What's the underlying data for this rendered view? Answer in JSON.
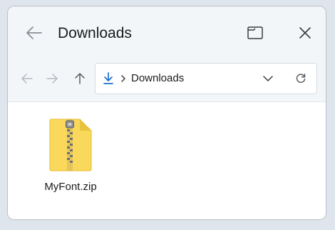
{
  "window": {
    "title": "Downloads"
  },
  "titlebar": {
    "back_icon": "arrow-left-icon",
    "restore_icon": "restore-window-icon",
    "close_icon": "close-icon"
  },
  "navigation": {
    "back_icon": "arrow-left-icon",
    "forward_icon": "arrow-right-icon",
    "up_icon": "arrow-up-icon"
  },
  "address_bar": {
    "location_icon": "download-icon",
    "separator_icon": "chevron-right-icon",
    "path": "Downloads",
    "dropdown_icon": "chevron-down-icon",
    "refresh_icon": "refresh-icon"
  },
  "files": [
    {
      "name": "MyFont.zip",
      "icon": "zip-folder-icon"
    }
  ],
  "colors": {
    "accent": "#1a6fd0",
    "zip_yellow": "#f9d85b",
    "titlebar_bg": "#f3f6f9"
  }
}
